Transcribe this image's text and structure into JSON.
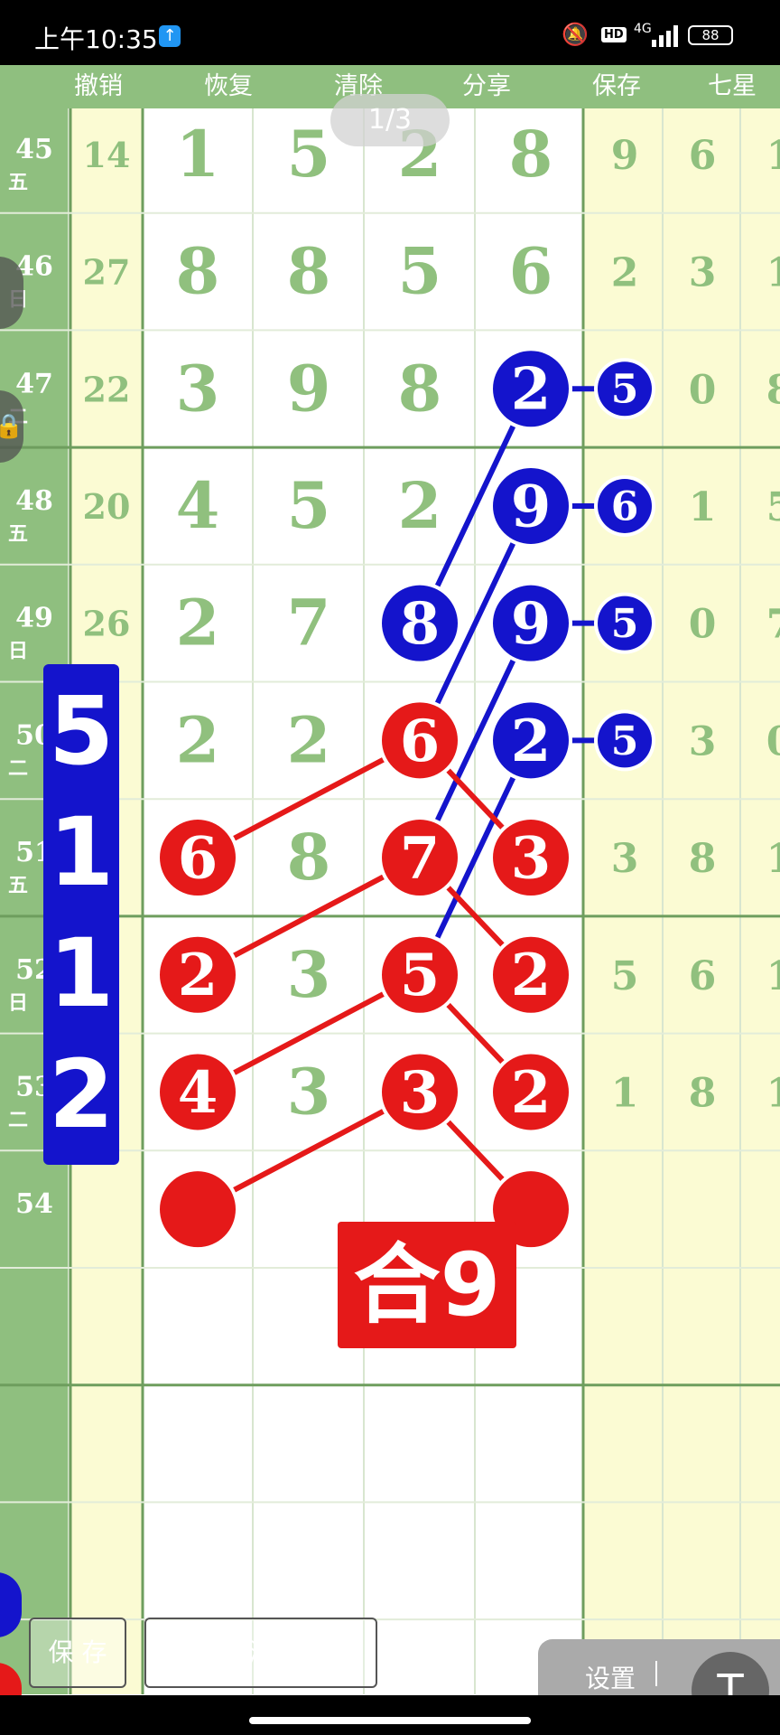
{
  "status_bar": {
    "time": "上午10:35",
    "network": "4G",
    "hd": "HD",
    "battery": "88"
  },
  "toolbar": {
    "items": [
      "撤销",
      "恢复",
      "清除",
      "分享",
      "保存",
      "七星彩"
    ]
  },
  "pager": "1/3",
  "rows": [
    {
      "period": "45",
      "weekday": "五",
      "sum": "14",
      "digits": [
        "1",
        "5",
        "2",
        "8"
      ],
      "tail": [
        "9",
        "6",
        "1"
      ]
    },
    {
      "period": "46",
      "weekday": "日",
      "sum": "27",
      "digits": [
        "8",
        "8",
        "5",
        "6"
      ],
      "tail": [
        "2",
        "3",
        "1"
      ]
    },
    {
      "period": "47",
      "weekday": "二",
      "sum": "22",
      "digits": [
        "3",
        "9",
        "8",
        ""
      ],
      "tail": [
        "",
        "0",
        "8"
      ]
    },
    {
      "period": "48",
      "weekday": "五",
      "sum": "20",
      "digits": [
        "4",
        "5",
        "2",
        ""
      ],
      "tail": [
        "",
        "1",
        "5"
      ]
    },
    {
      "period": "49",
      "weekday": "日",
      "sum": "26",
      "digits": [
        "2",
        "7",
        "",
        ""
      ],
      "tail": [
        "",
        "0",
        "7"
      ]
    },
    {
      "period": "50",
      "weekday": "二",
      "sum": "",
      "digits": [
        "2",
        "2",
        "",
        ""
      ],
      "tail": [
        "",
        "3",
        "0"
      ]
    },
    {
      "period": "51",
      "weekday": "五",
      "sum": "",
      "digits": [
        "",
        "8",
        "",
        ""
      ],
      "tail": [
        "3",
        "8",
        "1"
      ]
    },
    {
      "period": "52",
      "weekday": "日",
      "sum": "",
      "digits": [
        "",
        "3",
        "",
        ""
      ],
      "tail": [
        "5",
        "6",
        "1"
      ]
    },
    {
      "period": "53",
      "weekday": "二",
      "sum": "",
      "digits": [
        "",
        "3",
        "",
        ""
      ],
      "tail": [
        "1",
        "8",
        "1"
      ]
    },
    {
      "period": "54",
      "weekday": "",
      "sum": "",
      "digits": [
        "",
        "",
        "",
        ""
      ],
      "tail": [
        "",
        "",
        ""
      ]
    }
  ],
  "blue_balls": {
    "main": [
      {
        "row": 2,
        "col": 3,
        "value": "2"
      },
      {
        "row": 3,
        "col": 3,
        "value": "9"
      },
      {
        "row": 4,
        "col": 2,
        "value": "8"
      },
      {
        "row": 4,
        "col": 3,
        "value": "9"
      },
      {
        "row": 5,
        "col": 3,
        "value": "2"
      }
    ],
    "side": [
      {
        "row": 2,
        "value": "5"
      },
      {
        "row": 3,
        "value": "6"
      },
      {
        "row": 4,
        "value": "5"
      },
      {
        "row": 5,
        "value": "5"
      }
    ]
  },
  "red_balls": [
    {
      "row": 5,
      "col": 2,
      "value": "6"
    },
    {
      "row": 6,
      "col": 0,
      "value": "6"
    },
    {
      "row": 6,
      "col": 2,
      "value": "7"
    },
    {
      "row": 6,
      "col": 3,
      "value": "3"
    },
    {
      "row": 7,
      "col": 0,
      "value": "2"
    },
    {
      "row": 7,
      "col": 2,
      "value": "5"
    },
    {
      "row": 7,
      "col": 3,
      "value": "2"
    },
    {
      "row": 8,
      "col": 0,
      "value": "4"
    },
    {
      "row": 8,
      "col": 2,
      "value": "3"
    },
    {
      "row": 8,
      "col": 3,
      "value": "2"
    },
    {
      "row": 9,
      "col": 0,
      "value": ""
    },
    {
      "row": 9,
      "col": 3,
      "value": ""
    }
  ],
  "prediction_label": [
    "5",
    "1",
    "1",
    "2"
  ],
  "sum_label": "合9",
  "buttons": {
    "save": "保 存",
    "view_original": "点我看清晰原图",
    "settings": "设置"
  },
  "colors": {
    "grid_green": "#90c07e",
    "side_green": "#8fbf7f",
    "col_yellow": "#fbfbd3",
    "ball_red": "#e51919",
    "ball_blue": "#1414cc"
  }
}
